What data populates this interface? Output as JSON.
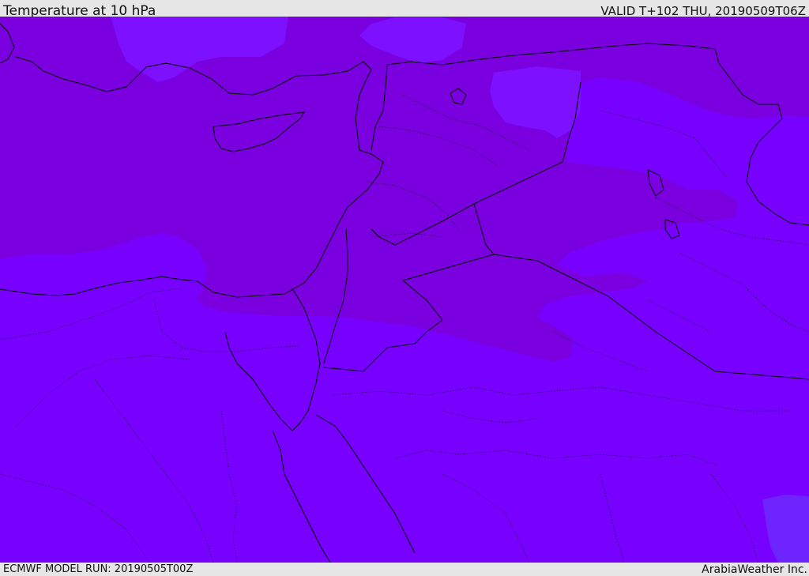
{
  "header": {
    "title": "Temperature at 10 hPa",
    "valid_time": "VALID T+102 THU, 20190509T06Z"
  },
  "footer": {
    "model_run": "ECMWF MODEL RUN: 20190505T00Z",
    "credit": "ArabiaWeather Inc."
  },
  "map": {
    "colors": {
      "base": "#7800ff",
      "warm": "#7a00e0",
      "cool": "#7c10ff",
      "coldest": "#6e24ff",
      "land_border": "#000000"
    }
  }
}
